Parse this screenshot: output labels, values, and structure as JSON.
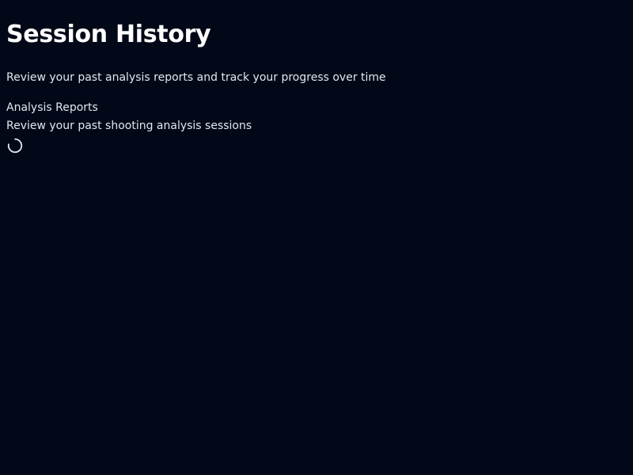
{
  "header": {
    "title": "Session History",
    "subtitle": "Review your past analysis reports and track your progress over time"
  },
  "reports": {
    "title": "Analysis Reports",
    "description": "Review your past shooting analysis sessions",
    "loading_icon": "spinner-icon"
  },
  "colors": {
    "background": "#020817",
    "text": "#f8fafc"
  }
}
